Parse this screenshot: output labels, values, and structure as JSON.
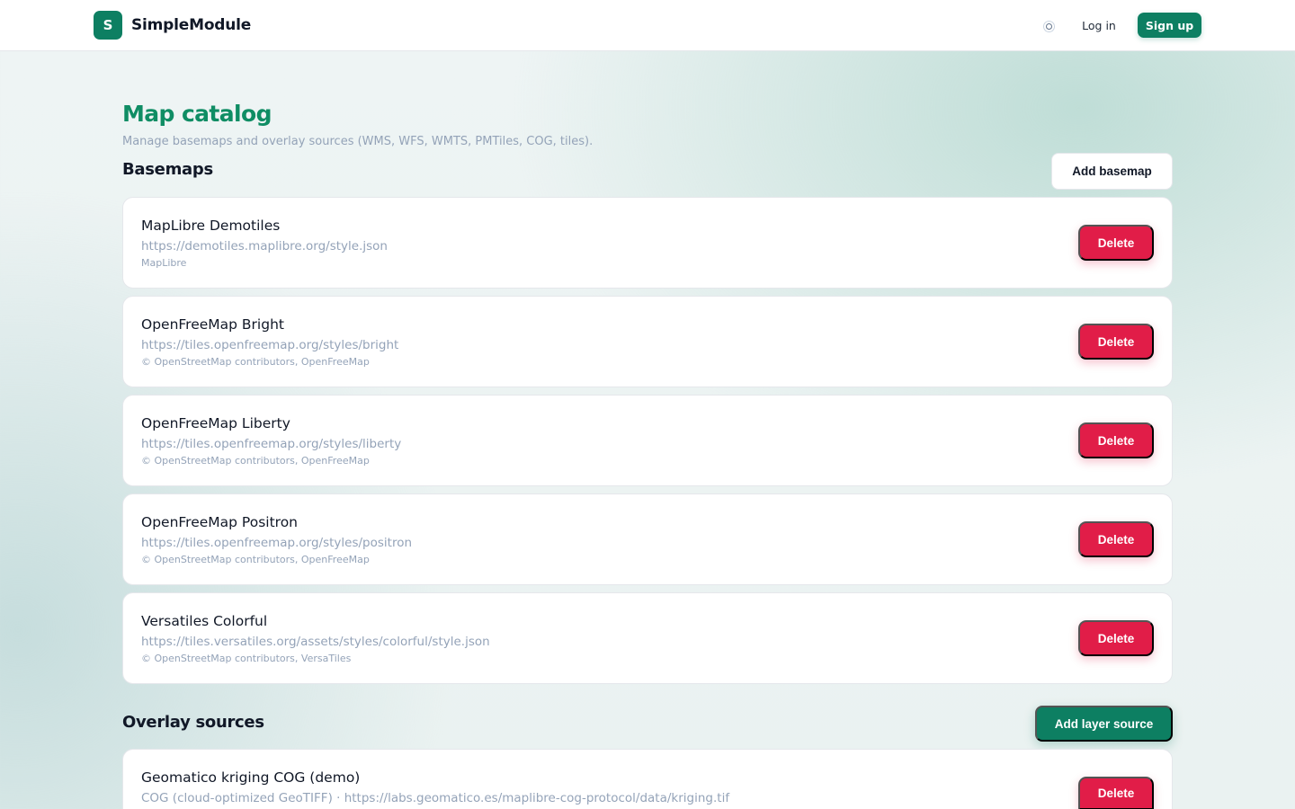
{
  "header": {
    "logo_letter": "S",
    "brand": "SimpleModule",
    "theme_icon": "sun-icon",
    "login_label": "Log in",
    "signup_label": "Sign up"
  },
  "page": {
    "title": "Map catalog",
    "subtitle": "Manage basemaps and overlay sources (WMS, WFS, WMTS, PMTiles, COG, tiles)."
  },
  "basemaps": {
    "title": "Basemaps",
    "add_label": "Add basemap",
    "items": [
      {
        "name": "MapLibre Demotiles",
        "url": "https://demotiles.maplibre.org/style.json",
        "attribution": "MapLibre",
        "delete_label": "Delete"
      },
      {
        "name": "OpenFreeMap Bright",
        "url": "https://tiles.openfreemap.org/styles/bright",
        "attribution": "© OpenStreetMap contributors, OpenFreeMap",
        "delete_label": "Delete"
      },
      {
        "name": "OpenFreeMap Liberty",
        "url": "https://tiles.openfreemap.org/styles/liberty",
        "attribution": "© OpenStreetMap contributors, OpenFreeMap",
        "delete_label": "Delete"
      },
      {
        "name": "OpenFreeMap Positron",
        "url": "https://tiles.openfreemap.org/styles/positron",
        "attribution": "© OpenStreetMap contributors, OpenFreeMap",
        "delete_label": "Delete"
      },
      {
        "name": "Versatiles Colorful",
        "url": "https://tiles.versatiles.org/assets/styles/colorful/style.json",
        "attribution": "© OpenStreetMap contributors, VersaTiles",
        "delete_label": "Delete"
      }
    ]
  },
  "overlays": {
    "title": "Overlay sources",
    "add_label": "Add layer source",
    "items": [
      {
        "name": "Geomatico kriging COG (demo)",
        "url": "COG (cloud-optimized GeoTIFF) · https://labs.geomatico.es/maplibre-cog-protocol/data/kriging.tif",
        "delete_label": "Delete"
      }
    ]
  },
  "colors": {
    "brand": "#0d7f62",
    "title_green": "#0f8d64",
    "danger": "#e11d48",
    "muted_text": "#94a3b8"
  }
}
